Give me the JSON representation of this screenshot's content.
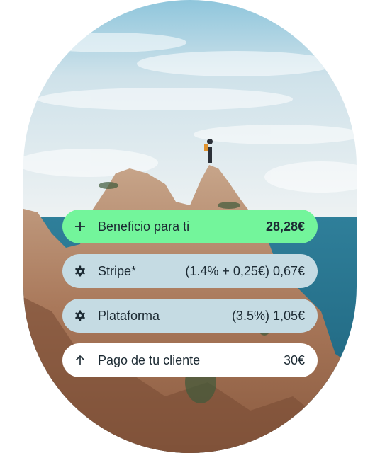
{
  "breakdown": {
    "profit": {
      "icon": "plus-icon",
      "label": "Beneficio para ti",
      "amount": "28,28€",
      "color": "#73f59b"
    },
    "stripe": {
      "icon": "gear-icon",
      "label": "Stripe*",
      "amount": "(1.4% + 0,25€) 0,67€",
      "color": "#c5dbe3"
    },
    "platform": {
      "icon": "gear-icon",
      "label": "Plataforma",
      "amount": "(3.5%) 1,05€",
      "color": "#c5dbe3"
    },
    "payment": {
      "icon": "arrow-up-icon",
      "label": "Pago de tu cliente",
      "amount": "30€",
      "color": "#ffffff"
    }
  }
}
